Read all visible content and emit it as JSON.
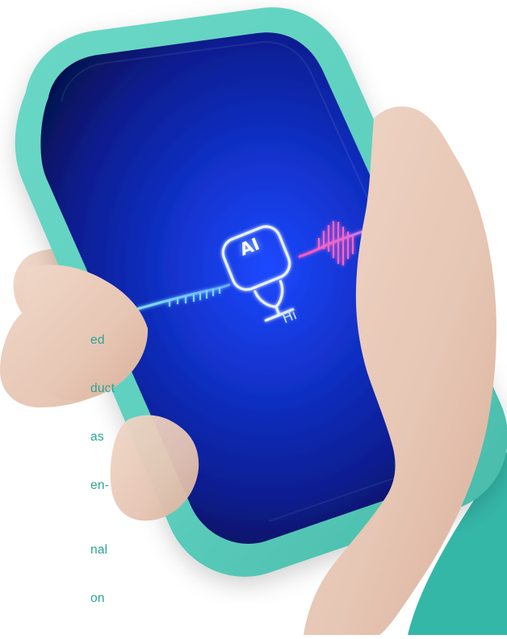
{
  "colors": {
    "accent_teal": "#2fb4a6",
    "phone_case": "#5ecfbe",
    "screen_dark": "#07186a",
    "glow_blue": "#3c78ff",
    "wave_pink": "#ff5fc0",
    "text_teal": "#2aa595"
  },
  "scene": {
    "description_icons": [
      "microphone-icon",
      "soundwave-icon"
    ]
  },
  "screen": {
    "badge": "AI",
    "greeting": "Hi"
  },
  "snippets": {
    "top": [
      "ed",
      "duct",
      "as",
      "en-"
    ],
    "bottom": [
      "nal",
      "on"
    ]
  }
}
